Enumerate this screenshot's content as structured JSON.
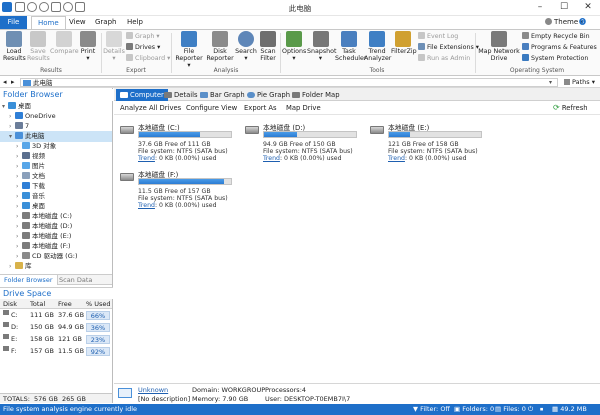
{
  "window": {
    "title": "此电脑"
  },
  "ribbon_tabs": [
    "File",
    "Home",
    "View",
    "Graph",
    "Help"
  ],
  "theme_label": "Theme",
  "ribbon": {
    "load_results": "Load\nResults",
    "save_results": "Save\nResults",
    "compare": "Compare",
    "print": "Print",
    "results_group": "Results",
    "details": "Details",
    "graph": "Graph",
    "drives": "Drives",
    "clipboard": "Clipboard",
    "export_group": "Export",
    "file_reporter": "File\nReporter",
    "disk_reporter": "Disk\nReporter",
    "search": "Search",
    "scan_filter": "Scan\nFilter",
    "analysis_group": "Analysis",
    "options": "Options",
    "snapshot": "Snapshot",
    "task_scheduler": "Task\nScheduler",
    "trend_analyzer": "Trend\nAnalyzer",
    "filterzip": "FilterZip",
    "event_log": "Event Log",
    "file_extensions": "File Extensions",
    "run_as_admin": "Run as Admin",
    "tools_group": "Tools",
    "map_network_drive": "Map Network\nDrive",
    "empty_recycle_bin": "Empty Recycle Bin",
    "programs_features": "Programs & Features",
    "system_protection": "System Protection",
    "os_group": "Operating System"
  },
  "address": {
    "path": "此电脑",
    "paths_label": "Paths"
  },
  "folder_browser": {
    "title": "Folder Browser",
    "tree": [
      {
        "label": "桌面",
        "indent": 0,
        "arrow": "▾",
        "color": "#3a8fd8"
      },
      {
        "label": "OneDrive",
        "indent": 1,
        "arrow": "›",
        "color": "#2f7fd6"
      },
      {
        "label": "7",
        "indent": 1,
        "arrow": "›",
        "color": "#6b7d99"
      },
      {
        "label": "此电脑",
        "indent": 1,
        "arrow": "▾",
        "color": "#4a90d9",
        "selected": true
      },
      {
        "label": "3D 对象",
        "indent": 2,
        "arrow": "›",
        "color": "#58a6e8"
      },
      {
        "label": "视频",
        "indent": 2,
        "arrow": "›",
        "color": "#5b6f8e"
      },
      {
        "label": "图片",
        "indent": 2,
        "arrow": "›",
        "color": "#58a6e8"
      },
      {
        "label": "文档",
        "indent": 2,
        "arrow": "›",
        "color": "#8aa0bb"
      },
      {
        "label": "下载",
        "indent": 2,
        "arrow": "›",
        "color": "#2f7fd6"
      },
      {
        "label": "音乐",
        "indent": 2,
        "arrow": "›",
        "color": "#3a8fd8"
      },
      {
        "label": "桌面",
        "indent": 2,
        "arrow": "›",
        "color": "#3a8fd8"
      },
      {
        "label": "本地磁盘 (C:)",
        "indent": 2,
        "arrow": "›",
        "color": "#7c7c7c"
      },
      {
        "label": "本地磁盘 (D:)",
        "indent": 2,
        "arrow": "›",
        "color": "#7c7c7c"
      },
      {
        "label": "本地磁盘 (E:)",
        "indent": 2,
        "arrow": "›",
        "color": "#7c7c7c"
      },
      {
        "label": "本地磁盘 (F:)",
        "indent": 2,
        "arrow": "›",
        "color": "#7c7c7c"
      },
      {
        "label": "CD 驱动器 (G:)",
        "indent": 2,
        "arrow": "›",
        "color": "#8a8a8a"
      },
      {
        "label": "库",
        "indent": 1,
        "arrow": "›",
        "color": "#d8b24a"
      },
      {
        "label": "网络",
        "indent": 1,
        "arrow": "›",
        "color": "#4a90d9"
      }
    ],
    "tab_folder_browser": "Folder Browser",
    "tab_scan_data": "Scan Data"
  },
  "drive_space": {
    "title": "Drive Space",
    "columns": [
      "Disk",
      "Total",
      "Free",
      "% Used"
    ],
    "rows": [
      {
        "disk": "C:",
        "total": "111 GB",
        "free": "37.6 GB",
        "used": "66%"
      },
      {
        "disk": "D:",
        "total": "150 GB",
        "free": "94.9 GB",
        "used": "36%"
      },
      {
        "disk": "E:",
        "total": "158 GB",
        "free": "121 GB",
        "used": "23%"
      },
      {
        "disk": "F:",
        "total": "157 GB",
        "free": "11.5 GB",
        "used": "92%"
      }
    ],
    "totals_label": "TOTALS:",
    "totals_total": "576 GB",
    "totals_free": "265 GB"
  },
  "main_tabs": [
    "Computer",
    "Details",
    "Bar Graph",
    "Pie Graph",
    "Folder Map"
  ],
  "actions": [
    "Analyze All Drives",
    "Configure View",
    "Export As",
    "Map Drive"
  ],
  "refresh_label": "Refresh",
  "drives": [
    {
      "name": "本地磁盘 (C:)",
      "free": "37.6 GB Free of 111 GB",
      "fs": "File system: NTFS (SATA bus)",
      "trend_label": "Trend",
      "trend": ": 0 KB (0.00%) used",
      "used_fraction": 0.66
    },
    {
      "name": "本地磁盘 (D:)",
      "free": "94.9 GB Free of 150 GB",
      "fs": "File system: NTFS (SATA bus)",
      "trend_label": "Trend",
      "trend": ": 0 KB (0.00%) used",
      "used_fraction": 0.36
    },
    {
      "name": "本地磁盘 (E:)",
      "free": "121 GB Free of 158 GB",
      "fs": "File system: NTFS (SATA bus)",
      "trend_label": "Trend",
      "trend": ": 0 KB (0.00%) used",
      "used_fraction": 0.23
    },
    {
      "name": "本地磁盘 (F:)",
      "free": "11.5 GB Free of 157 GB",
      "fs": "File system: NTFS (SATA bus)",
      "trend_label": "Trend",
      "trend": ": 0 KB (0.00%) used",
      "used_fraction": 0.92
    }
  ],
  "info": {
    "unknown": "Unknown",
    "no_description": "[No description]",
    "domain": "Domain: WORKGROUP",
    "memory": "Memory: 7.90 GB",
    "processors": "Processors:4",
    "user": "User: DESKTOP-T0EMB7I\\7"
  },
  "statusbar": {
    "message": "File system analysis engine currently idle",
    "filter": "Filter: Off",
    "folders": "Folders: 0",
    "files": "Files: 0",
    "memory": "49.2 MB"
  }
}
